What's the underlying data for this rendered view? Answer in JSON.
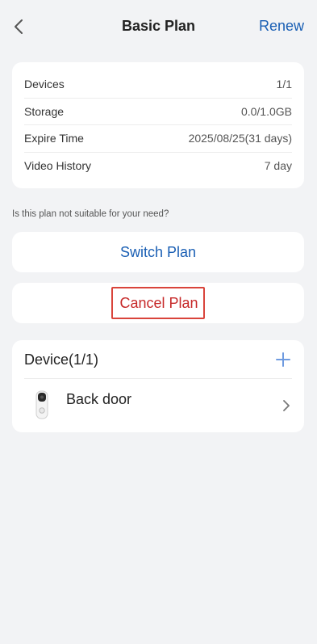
{
  "header": {
    "title": "Basic Plan",
    "renew_label": "Renew",
    "back_icon": "back-chevron-icon"
  },
  "plan_info": [
    {
      "label": "Devices",
      "value": "1/1"
    },
    {
      "label": "Storage",
      "value": "0.0/1.0GB"
    },
    {
      "label": "Expire Time",
      "value": "2025/08/25(31 days)"
    },
    {
      "label": "Video History",
      "value": "7 day"
    }
  ],
  "hint": "Is this plan not suitable for your need?",
  "actions": {
    "switch_label": "Switch Plan",
    "cancel_label": "Cancel Plan"
  },
  "devices": {
    "title": "Device(1/1)",
    "add_icon": "plus-icon",
    "items": [
      {
        "name": "Back door",
        "icon": "doorbell-icon"
      }
    ]
  },
  "colors": {
    "background": "#f2f3f5",
    "accent": "#1a5fb4",
    "danger": "#c62828",
    "highlight_border": "#d9443b"
  }
}
